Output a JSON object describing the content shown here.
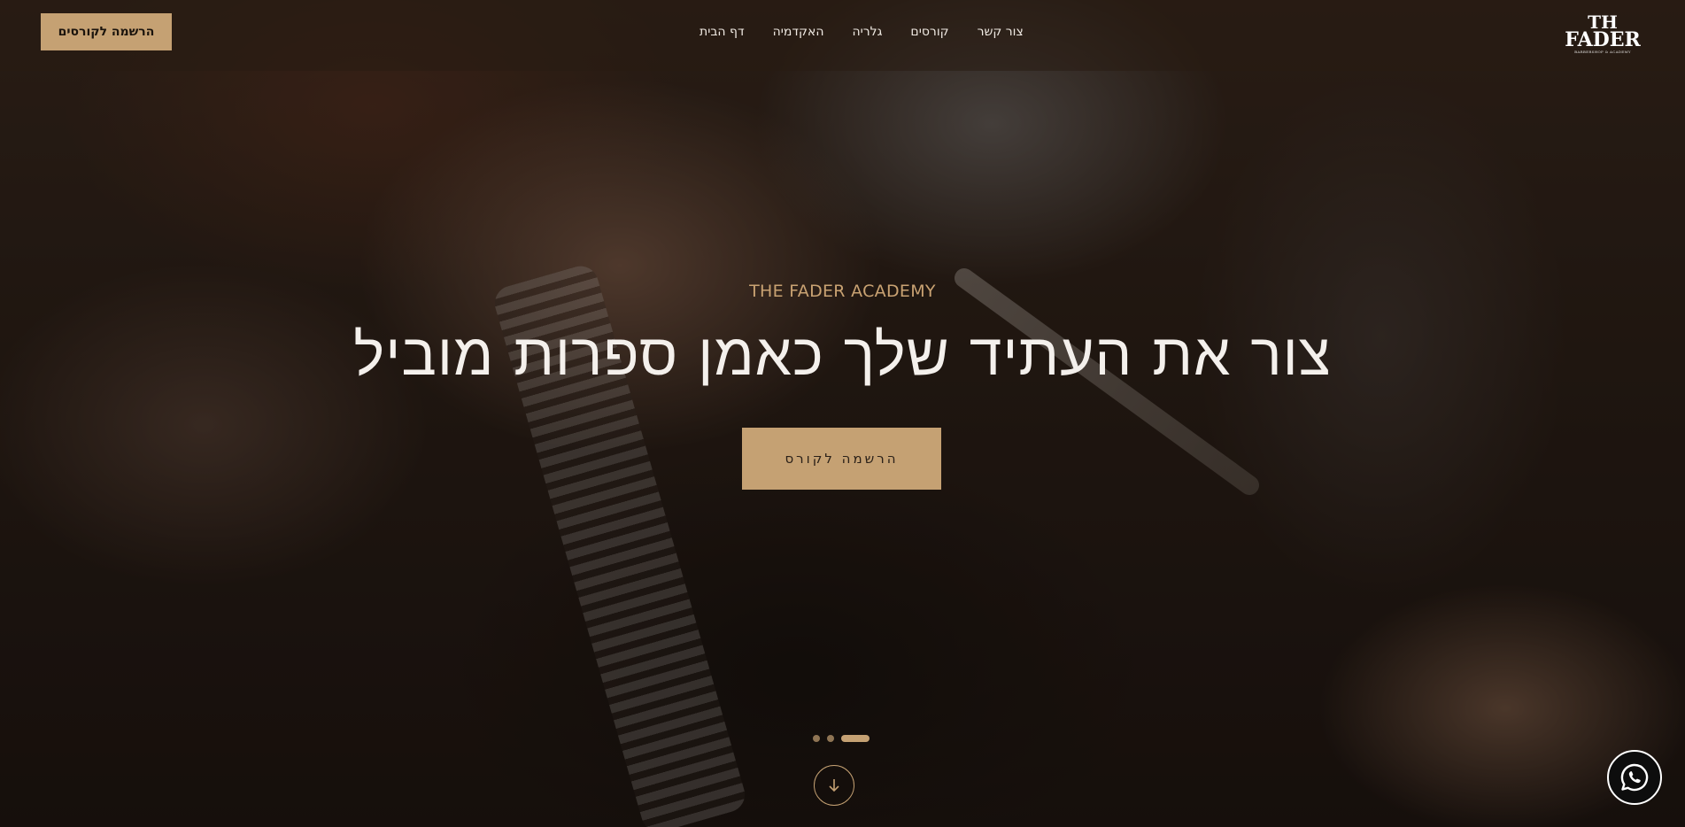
{
  "header": {
    "cta_label": "הרשמה לקורסים",
    "nav": [
      {
        "label": "דף הבית"
      },
      {
        "label": "האקדמיה"
      },
      {
        "label": "גלריה"
      },
      {
        "label": "קורסים"
      },
      {
        "label": "צור קשר"
      }
    ],
    "logo": {
      "line1": "TH",
      "line2": "FADER",
      "line3": "BARBERSHOP & ACADEMY"
    }
  },
  "hero": {
    "eyebrow": "THE FADER ACADEMY",
    "headline": "צור את העתיד שלך כאמן ספרות מוביל",
    "cta_label": "הרשמה לקורס",
    "slider": {
      "count": 3,
      "active_index": 2
    }
  },
  "icons": {
    "scroll": "arrow-down-icon",
    "chat": "whatsapp-icon"
  },
  "colors": {
    "accent": "#c5a173",
    "text_light": "#efe9e2"
  }
}
